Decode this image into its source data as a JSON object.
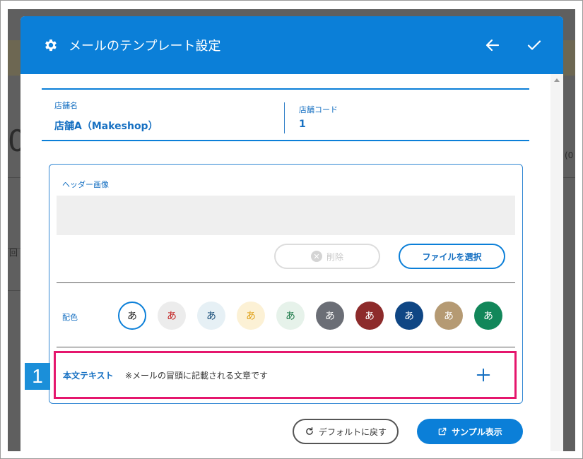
{
  "dialog": {
    "title": "メールのテンプレート設定",
    "accent_color": "#0b7fd8"
  },
  "store": {
    "name_label": "店舗名",
    "name_value": "店舗A（Makeshop）",
    "code_label": "店舗コード",
    "code_value": "1"
  },
  "header_image": {
    "label": "ヘッダー画像",
    "delete_label": "削除",
    "select_file_label": "ファイルを選択"
  },
  "color_scheme": {
    "label": "配色",
    "swatches": [
      {
        "char": "あ",
        "bg": "#ffffff",
        "fg": "#222222",
        "selected": true
      },
      {
        "char": "あ",
        "bg": "#ececec",
        "fg": "#c42626"
      },
      {
        "char": "あ",
        "bg": "#e6f0f5",
        "fg": "#1a4f7a"
      },
      {
        "char": "あ",
        "bg": "#fcf1d5",
        "fg": "#e0a21b"
      },
      {
        "char": "あ",
        "bg": "#e6f2ea",
        "fg": "#1e7a4a"
      },
      {
        "char": "あ",
        "bg": "#6b6e76",
        "fg": "#ffffff"
      },
      {
        "char": "あ",
        "bg": "#8d2b2b",
        "fg": "#ffffff"
      },
      {
        "char": "あ",
        "bg": "#0f4684",
        "fg": "#ffffff"
      },
      {
        "char": "あ",
        "bg": "#b59a73",
        "fg": "#ffffff"
      },
      {
        "char": "あ",
        "bg": "#12875a",
        "fg": "#ffffff"
      }
    ]
  },
  "body_text": {
    "marker": "1",
    "title": "本文テキスト",
    "note": "※メールの冒頭に記載される文章です"
  },
  "footer": {
    "default_label": "デフォルトに戻す",
    "sample_label": "サンプル表示"
  }
}
